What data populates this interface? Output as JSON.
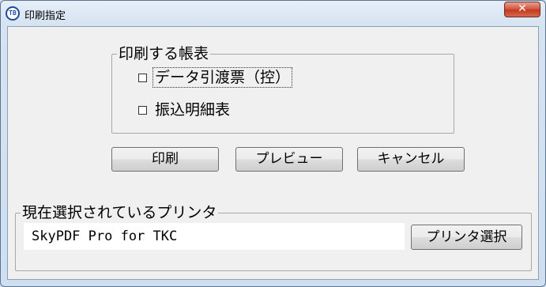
{
  "window": {
    "title": "印刷指定",
    "app_icon_text": "TB",
    "close_symbol": "✕"
  },
  "reports_group": {
    "legend": "印刷する帳表",
    "options": [
      {
        "label": "データ引渡票（控）",
        "checked": false,
        "focused": true
      },
      {
        "label": "振込明細表",
        "checked": false,
        "focused": false
      }
    ]
  },
  "buttons": {
    "print": "印刷",
    "preview": "プレビュー",
    "cancel": "キャンセル"
  },
  "printer_group": {
    "legend": "現在選択されているプリンタ",
    "printer_name": "SkyPDF Pro for TKC",
    "select_button": "プリンタ選択"
  }
}
